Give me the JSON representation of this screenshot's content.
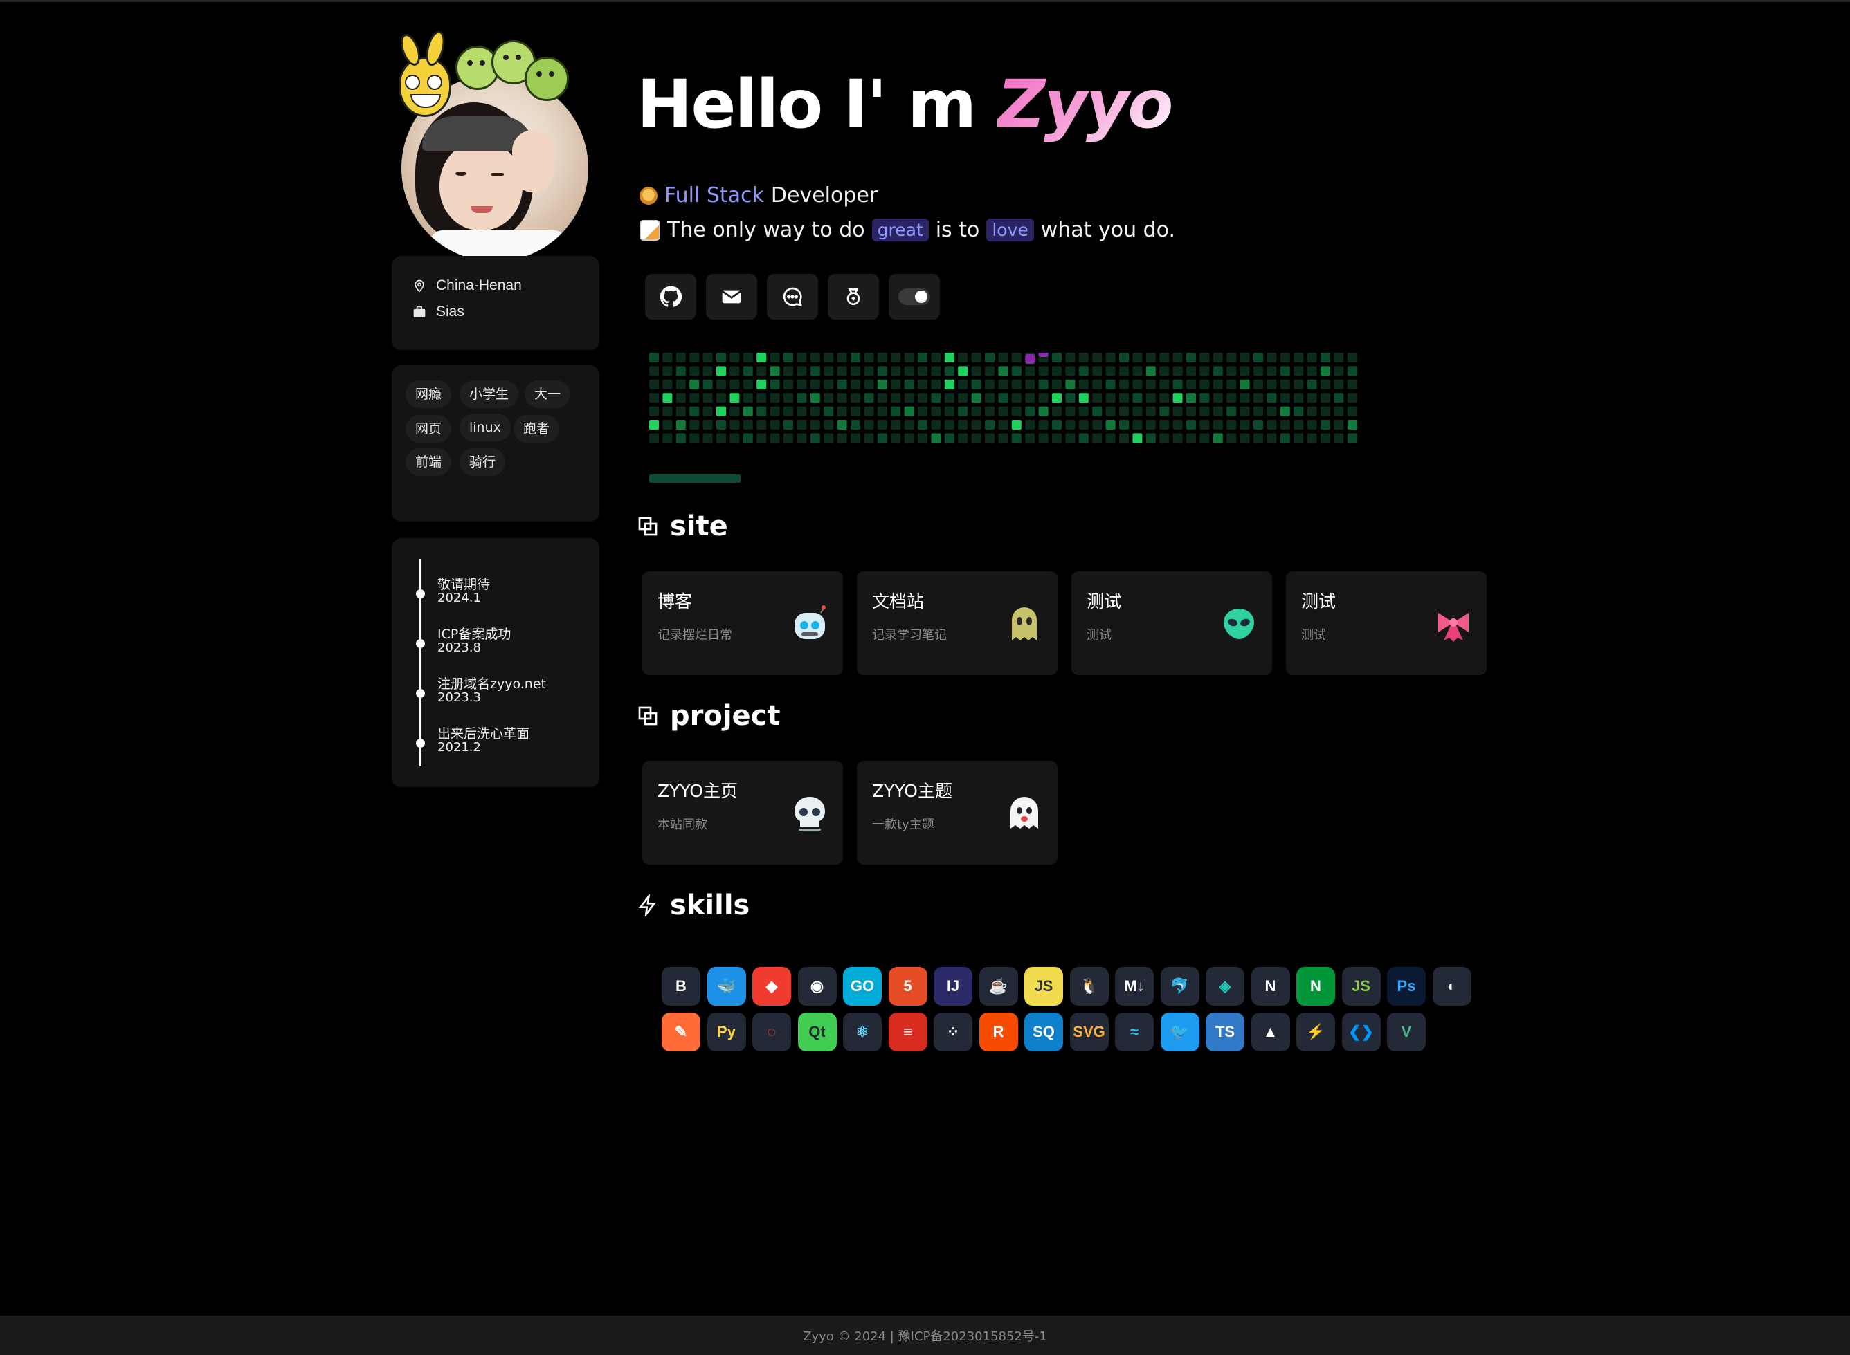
{
  "profile": {
    "greeting_prefix": "Hello I' m ",
    "name": "Zyyo",
    "role_accent": "Full Stack",
    "role_rest": "Developer",
    "quote_1": "The only way to do",
    "quote_chip_1": "great",
    "quote_2": "is to",
    "quote_chip_2": "love",
    "quote_3": "what you do."
  },
  "info": {
    "location": "China-Henan",
    "school": "Sias"
  },
  "tags": [
    "网瘾",
    "小学生",
    "大一",
    "网页",
    "linux",
    "跑者",
    "前端",
    "骑行"
  ],
  "timeline": [
    {
      "title": "敬请期待",
      "date": "2024.1"
    },
    {
      "title": "ICP备案成功",
      "date": "2023.8"
    },
    {
      "title": "注册域名zyyo.net",
      "date": "2023.3"
    },
    {
      "title": "出来后洗心革面",
      "date": "2021.2"
    }
  ],
  "links": [
    {
      "icon": "github-icon"
    },
    {
      "icon": "mail-icon"
    },
    {
      "icon": "chat-icon"
    },
    {
      "icon": "reward-icon"
    },
    {
      "icon": "theme-toggle"
    }
  ],
  "contribution": {
    "weeks": 53,
    "days": 7,
    "colors": {
      "empty": "#0d2b1a",
      "low": "#0a4a2a",
      "mid": "#127a3a",
      "high": "#1fd15e",
      "snake": "#8a2ab0"
    }
  },
  "sections": {
    "site": "site",
    "project": "project",
    "skills": "skills"
  },
  "sites": [
    {
      "title": "博客",
      "desc": "记录摆烂日常",
      "icon": "robot-icon"
    },
    {
      "title": "文档站",
      "desc": "记录学习笔记",
      "icon": "ghost-icon"
    },
    {
      "title": "测试",
      "desc": "测试",
      "icon": "alien-icon"
    },
    {
      "title": "测试",
      "desc": "测试",
      "icon": "ribbon-icon"
    }
  ],
  "projects": [
    {
      "title": "ZYYO主页",
      "desc": "本站同款",
      "icon": "skull-icon"
    },
    {
      "title": "ZYYO主题",
      "desc": "一款ty主题",
      "icon": "ghost-icon"
    }
  ],
  "skills_row1": [
    {
      "name": "bootstrap-icon",
      "label": "B",
      "bg": "#242938",
      "fg": "#ffffff"
    },
    {
      "name": "docker-icon",
      "label": "🐳",
      "bg": "#1d91e6",
      "fg": "#ffffff"
    },
    {
      "name": "git-icon",
      "label": "◆",
      "bg": "#f03c2e",
      "fg": "#ffffff"
    },
    {
      "name": "github-icon",
      "label": "◉",
      "bg": "#242938",
      "fg": "#ffffff"
    },
    {
      "name": "go-icon",
      "label": "GO",
      "bg": "#00acd7",
      "fg": "#ffffff"
    },
    {
      "name": "html5-icon",
      "label": "5",
      "bg": "#e44d26",
      "fg": "#ffffff"
    },
    {
      "name": "intellij-icon",
      "label": "IJ",
      "bg": "#2b2b6a",
      "fg": "#ffffff"
    },
    {
      "name": "java-icon",
      "label": "☕",
      "bg": "#242938",
      "fg": "#e76f00"
    },
    {
      "name": "javascript-icon",
      "label": "JS",
      "bg": "#f0db4f",
      "fg": "#323330"
    },
    {
      "name": "linux-icon",
      "label": "🐧",
      "bg": "#242938",
      "fg": "#ffffff"
    },
    {
      "name": "markdown-icon",
      "label": "M↓",
      "bg": "#242938",
      "fg": "#ffffff"
    },
    {
      "name": "mysql-icon",
      "label": "🐬",
      "bg": "#242938",
      "fg": "#ffffff"
    },
    {
      "name": "netlify-icon",
      "label": "◈",
      "bg": "#242938",
      "fg": "#25c7b7"
    },
    {
      "name": "nextjs-icon",
      "label": "N",
      "bg": "#242938",
      "fg": "#ffffff"
    },
    {
      "name": "nginx-icon",
      "label": "N",
      "bg": "#009639",
      "fg": "#ffffff"
    },
    {
      "name": "nodejs-icon",
      "label": "JS",
      "bg": "#242938",
      "fg": "#8cc84b"
    },
    {
      "name": "photoshop-icon",
      "label": "Ps",
      "bg": "#0a1a33",
      "fg": "#31a8ff"
    },
    {
      "name": "planetscale-icon",
      "label": "◐",
      "bg": "#242938",
      "fg": "#ffffff"
    }
  ],
  "skills_row2": [
    {
      "name": "postman-icon",
      "label": "✎",
      "bg": "#ff6c37",
      "fg": "#ffffff"
    },
    {
      "name": "python-icon",
      "label": "Py",
      "bg": "#242938",
      "fg": "#ffd43b"
    },
    {
      "name": "pytorch-icon",
      "label": "◌",
      "bg": "#242938",
      "fg": "#ee4c2c"
    },
    {
      "name": "qt-icon",
      "label": "Qt",
      "bg": "#41cd52",
      "fg": "#242938"
    },
    {
      "name": "react-icon",
      "label": "⚛",
      "bg": "#242938",
      "fg": "#61dafb"
    },
    {
      "name": "redis-icon",
      "label": "≡",
      "bg": "#d82c20",
      "fg": "#ffffff"
    },
    {
      "name": "remix-icon",
      "label": "⁘",
      "bg": "#242938",
      "fg": "#ffffff"
    },
    {
      "name": "rust-icon",
      "label": "R",
      "bg": "#f74c00",
      "fg": "#ffffff"
    },
    {
      "name": "sqlite-icon",
      "label": "SQ",
      "bg": "#0f80cc",
      "fg": "#ffffff"
    },
    {
      "name": "svg-icon",
      "label": "SVG",
      "bg": "#242938",
      "fg": "#ffb13b"
    },
    {
      "name": "tailwind-icon",
      "label": "≈",
      "bg": "#242938",
      "fg": "#38bdf8"
    },
    {
      "name": "twitter-icon",
      "label": "🐦",
      "bg": "#1d9bf0",
      "fg": "#ffffff"
    },
    {
      "name": "typescript-icon",
      "label": "TS",
      "bg": "#3178c6",
      "fg": "#ffffff"
    },
    {
      "name": "vercel-icon",
      "label": "▲",
      "bg": "#242938",
      "fg": "#ffffff"
    },
    {
      "name": "vite-icon",
      "label": "⚡",
      "bg": "#242938",
      "fg": "#bd34fe"
    },
    {
      "name": "vscode-icon",
      "label": "❮❯",
      "bg": "#242938",
      "fg": "#0098ff"
    },
    {
      "name": "vue-icon",
      "label": "V",
      "bg": "#242938",
      "fg": "#42b883"
    }
  ],
  "footer": "Zyyo © 2024 | 豫ICP备2023015852号-1"
}
